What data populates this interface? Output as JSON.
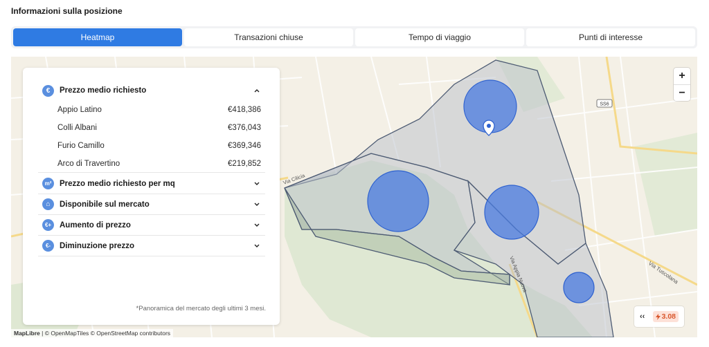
{
  "page": {
    "title": "Informazioni sulla posizione"
  },
  "tabs": [
    {
      "label": "Heatmap",
      "active": true
    },
    {
      "label": "Transazioni chiuse",
      "active": false
    },
    {
      "label": "Tempo di viaggio",
      "active": false
    },
    {
      "label": "Punti di interesse",
      "active": false
    }
  ],
  "map": {
    "zoom_in": "+",
    "zoom_out": "−",
    "labels": {
      "road_ss6": "SS6",
      "via_tuscolana": "Via Tuscolana",
      "via_appia_nuova": "Via Appia Nuova",
      "via_cilicia": "Via Cilicia"
    },
    "attribution": {
      "maplibre": "MapLibre",
      "rest": " | © OpenMapTiles © OpenStreetMap contributors"
    }
  },
  "panel": {
    "sections": [
      {
        "icon": "€",
        "label": "Prezzo medio richiesto",
        "expanded": true,
        "rows": [
          {
            "name": "Appio Latino",
            "value": "€418,386"
          },
          {
            "name": "Colli Albani",
            "value": "€376,043"
          },
          {
            "name": "Furio Camillo",
            "value": "€369,346"
          },
          {
            "name": "Arco di Travertino",
            "value": "€219,852"
          }
        ]
      },
      {
        "icon": "m²",
        "label": "Prezzo medio richiesto per mq",
        "expanded": false
      },
      {
        "icon": "⌂",
        "label": "Disponibile sul mercato",
        "expanded": false
      },
      {
        "icon": "€+",
        "label": "Aumento di prezzo",
        "expanded": false
      },
      {
        "icon": "€-",
        "label": "Diminuzione prezzo",
        "expanded": false
      }
    ],
    "footnote": "*Panoramica del mercato degli ultimi 3 mesi."
  },
  "badge": {
    "collapse": "‹‹",
    "score": "3.08",
    "score_icon": "bolt-icon"
  },
  "colors": {
    "accent": "#2f7be3",
    "bubble": "#4a7be0",
    "score_bg": "#fde1d8",
    "score_fg": "#d9582e"
  }
}
